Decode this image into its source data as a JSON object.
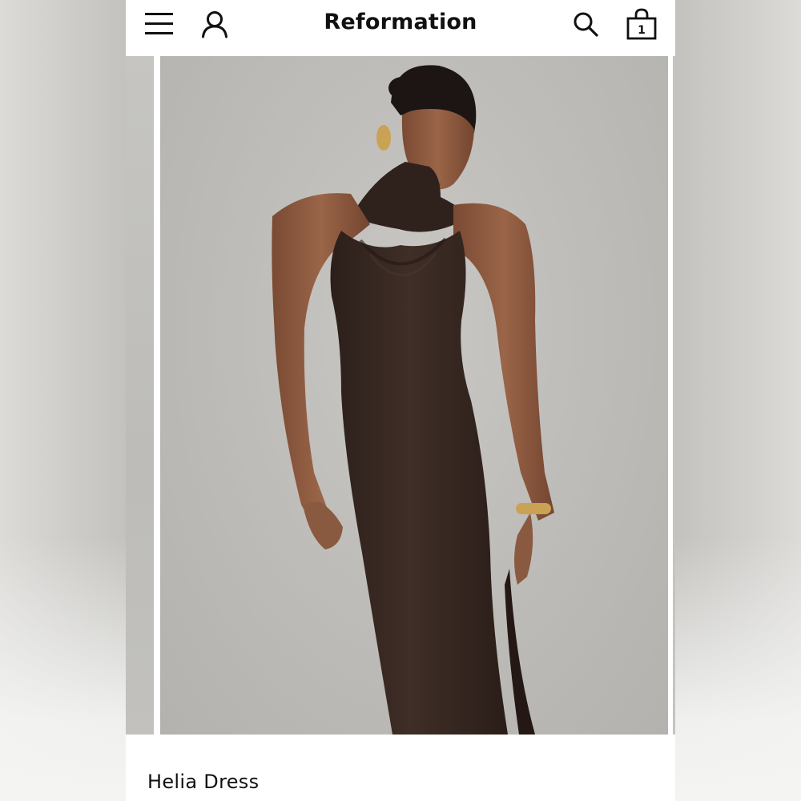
{
  "header": {
    "brand": "Reformation",
    "bag_count": "1",
    "icons": {
      "menu": "hamburger-menu-icon",
      "account": "user-account-icon",
      "search": "search-icon",
      "bag": "shopping-bag-icon"
    }
  },
  "gallery": {
    "main_image": "model in brown halter midi dress",
    "colors": {
      "backdrop": "#bebcb8",
      "dress": "#3a2a24",
      "skin": "#8a5a40",
      "hair": "#1a1412",
      "gold": "#c9a254"
    }
  },
  "product": {
    "name": "Helia Dress"
  }
}
